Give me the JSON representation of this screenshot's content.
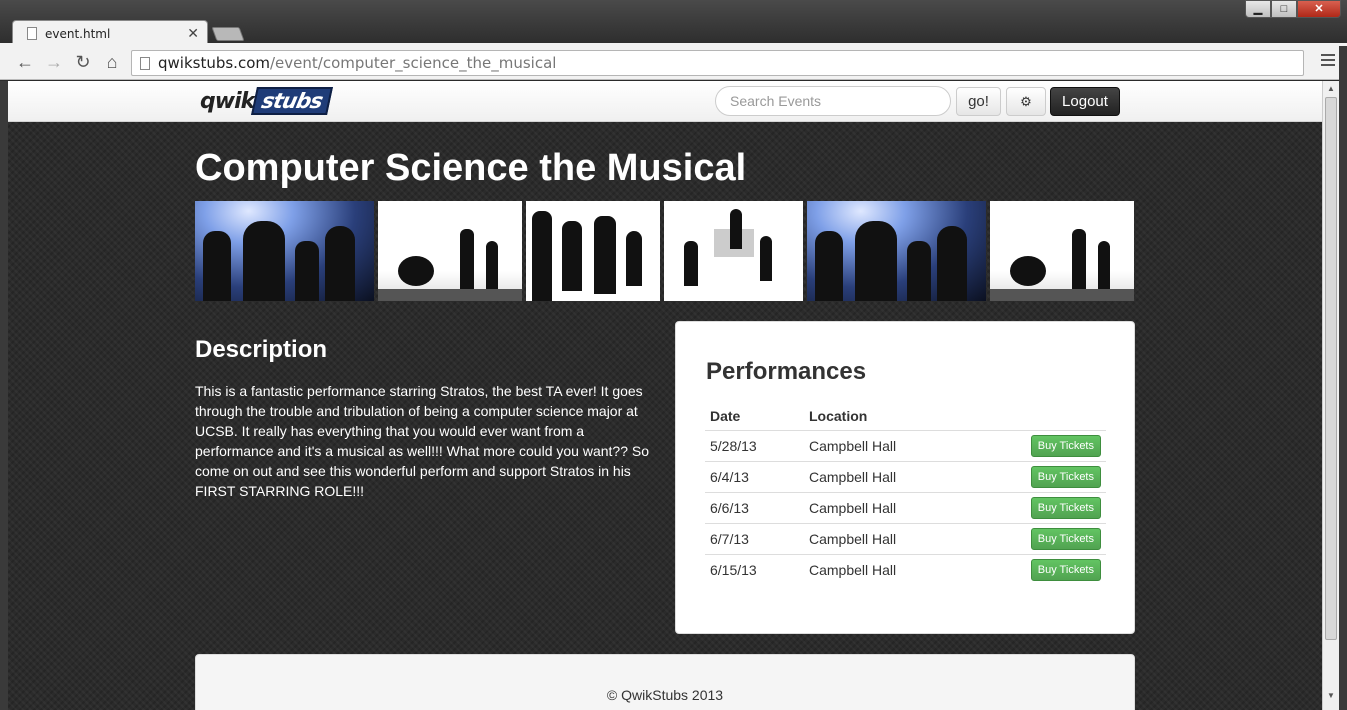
{
  "browser": {
    "tab_title": "event.html",
    "url_host": "qwikstubs.com",
    "url_path": "/event/computer_science_the_musical",
    "icons": [
      "back-icon",
      "forward-icon",
      "reload-icon",
      "home-icon",
      "menu-icon",
      "close-icon"
    ]
  },
  "navbar": {
    "brand_part1": "qwik",
    "brand_part2": "stubs",
    "search_placeholder": "Search Events",
    "go_label": "go!",
    "logout_label": "Logout",
    "gear_icon": "gear-icon",
    "brand_color": "#1f3c78"
  },
  "event": {
    "title": "Computer Science the Musical",
    "description_heading": "Description",
    "description": "This is a fantastic performance starring Stratos, the best TA ever! It goes through the trouble and tribulation of being a computer science major at UCSB. It really has everything that you would ever want from a performance and it's a musical as well!!! What more could you want?? So come on out and see this wonderful perform and support Stratos in his FIRST STARRING ROLE!!!"
  },
  "performances": {
    "heading": "Performances",
    "columns": [
      "Date",
      "Location"
    ],
    "rows": [
      {
        "date": "5/28/13",
        "location": "Campbell Hall",
        "action": "Buy Tickets"
      },
      {
        "date": "6/4/13",
        "location": "Campbell Hall",
        "action": "Buy Tickets"
      },
      {
        "date": "6/6/13",
        "location": "Campbell Hall",
        "action": "Buy Tickets"
      },
      {
        "date": "6/7/13",
        "location": "Campbell Hall",
        "action": "Buy Tickets"
      },
      {
        "date": "6/15/13",
        "location": "Campbell Hall",
        "action": "Buy Tickets"
      }
    ],
    "button_color": "#5bb75b"
  },
  "footer": {
    "text": "© QwikStubs 2013"
  }
}
